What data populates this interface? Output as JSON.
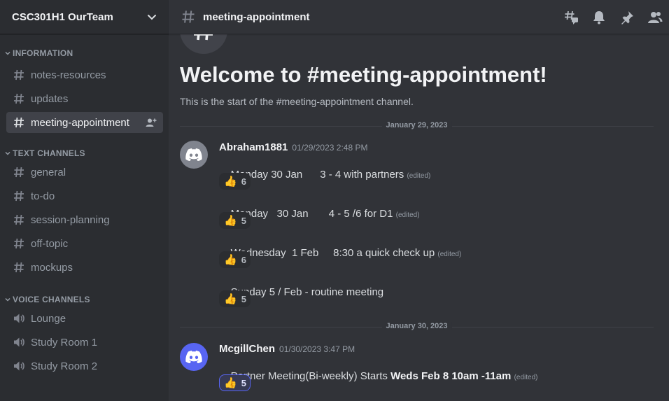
{
  "server": {
    "name": "CSC301H1 OurTeam"
  },
  "categories": [
    {
      "label": "INFORMATION",
      "channels": [
        "notes-resources",
        "updates",
        "meeting-appointment"
      ]
    },
    {
      "label": "TEXT CHANNELS",
      "channels": [
        "general",
        "to-do",
        "session-planning",
        "off-topic",
        "mockups"
      ]
    },
    {
      "label": "VOICE CHANNELS",
      "channels": [
        "Lounge",
        "Study Room 1",
        "Study Room 2"
      ]
    }
  ],
  "active_channel": "meeting-appointment",
  "topbar": {
    "title": "meeting-appointment",
    "icons": [
      "threads-icon",
      "bell-icon",
      "pin-icon",
      "members-icon"
    ]
  },
  "welcome": {
    "title": "Welcome to #meeting-appointment!",
    "subtitle": "This is the start of the #meeting-appointment channel."
  },
  "dividers": [
    "January 29, 2023",
    "January 30, 2023"
  ],
  "edited_label": "(edited)",
  "messages": [
    {
      "author": "Abraham1881",
      "timestamp": "01/29/2023 2:48 PM",
      "avatar_color": "#80848e",
      "lines": [
        {
          "text": "Monday 30 Jan      3 - 4 with partners",
          "reaction": "6"
        },
        {
          "text": "Monday   30 Jan       4 - 5 /6 for D1",
          "reaction": "5"
        },
        {
          "text": "Wednesday  1 Feb     8:30 a quick check up",
          "reaction": "6"
        },
        {
          "text": "Sunday 5 / Feb - routine meeting",
          "reaction": "5"
        }
      ]
    },
    {
      "author": "McgillChen",
      "timestamp": "01/30/2023 3:47 PM",
      "avatar_color": "#5865f2",
      "text": "Partner Meeting(Bi-weekly) Starts ",
      "bold": "Weds Feb 8 10am -11am",
      "reaction": "5"
    }
  ],
  "reaction_emoji": "👍",
  "colors": {
    "accent": "#5865f2",
    "sidebar": "#2b2d31",
    "main": "#313338"
  }
}
